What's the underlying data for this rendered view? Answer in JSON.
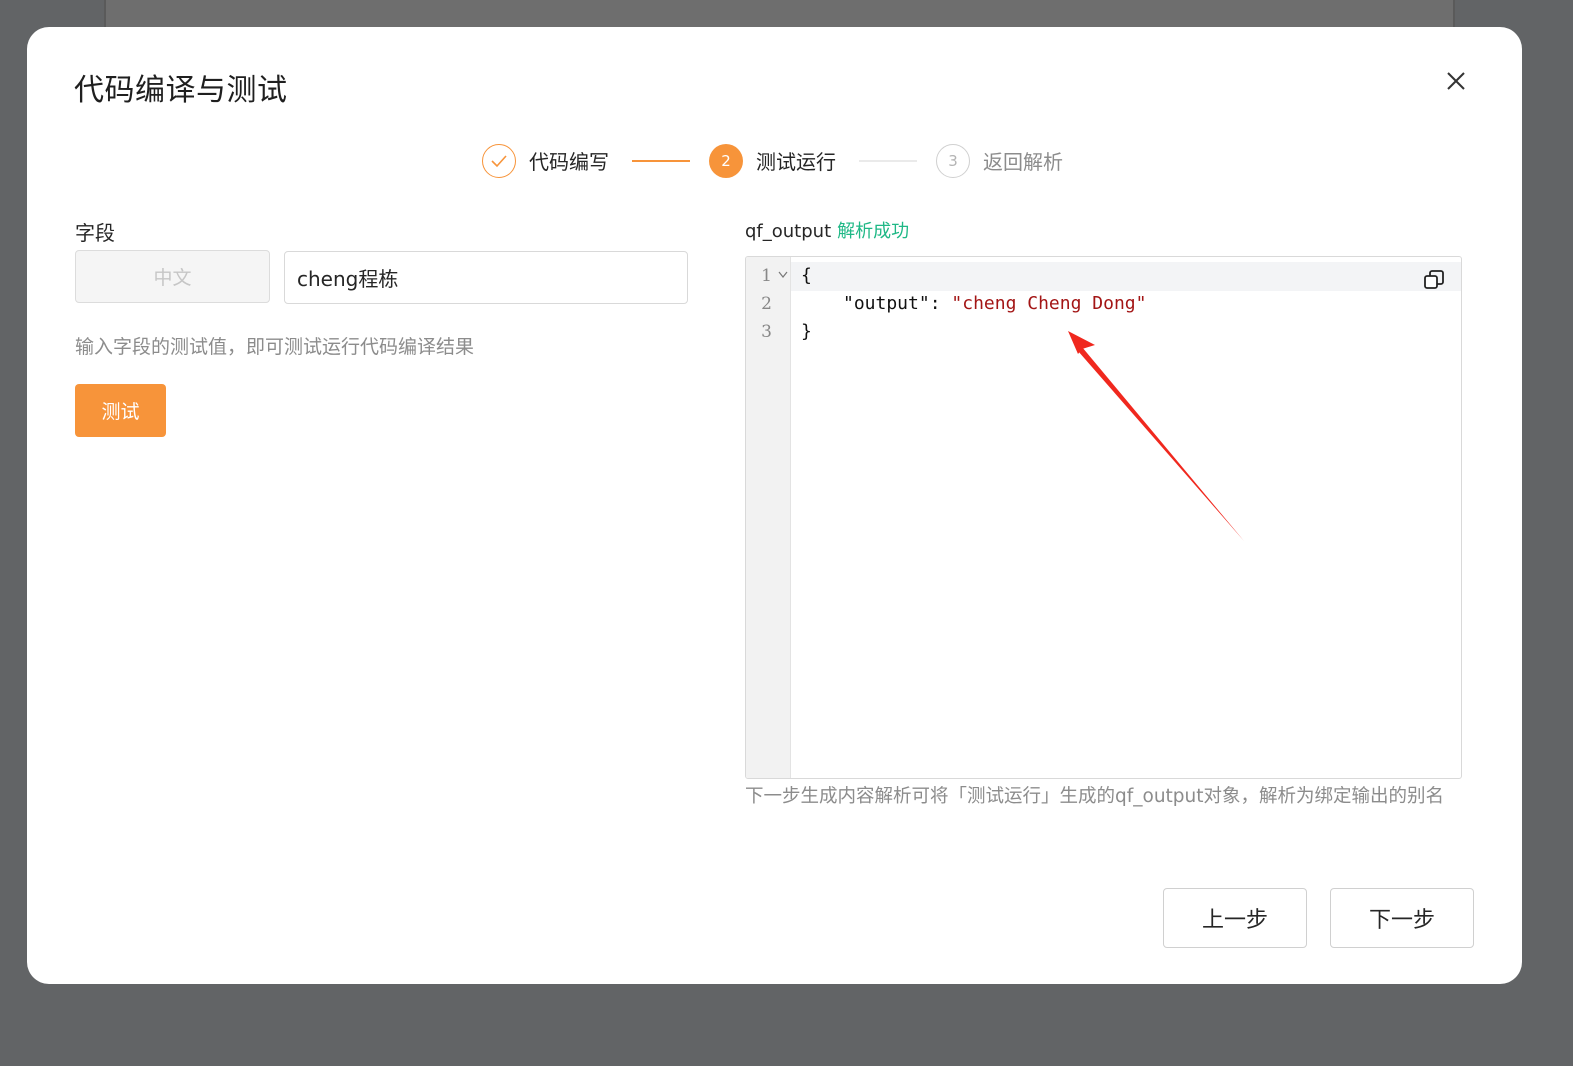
{
  "dialog": {
    "title": "代码编译与测试"
  },
  "steps": [
    {
      "number": "1",
      "label": "代码编写",
      "status": "done"
    },
    {
      "number": "2",
      "label": "测试运行",
      "status": "active"
    },
    {
      "number": "3",
      "label": "返回解析",
      "status": "pending"
    }
  ],
  "left_panel": {
    "field_label": "字段",
    "language_tag": "中文",
    "input_value": "cheng程栋",
    "hint": "输入字段的测试值，即可测试运行代码编译结果",
    "test_button": "测试"
  },
  "right_panel": {
    "output_name": "qf_output",
    "status": "解析成功",
    "line_numbers": [
      "1",
      "2",
      "3"
    ],
    "code_line1": "{",
    "code_key": "\"output\"",
    "code_colon": ": ",
    "code_value": "\"cheng Cheng Dong\"",
    "code_line3": "}",
    "hint": "下一步生成内容解析可将「测试运行」生成的qf_output对象，解析为绑定输出的别名"
  },
  "footer": {
    "prev_button": "上一步",
    "next_button": "下一步"
  },
  "colors": {
    "accent": "#f7943a",
    "success": "#1fb886",
    "annotation_arrow": "#f0281e"
  },
  "icons": [
    "close-icon",
    "check-icon",
    "fold-icon",
    "copy-icon",
    "annotation-arrow"
  ]
}
